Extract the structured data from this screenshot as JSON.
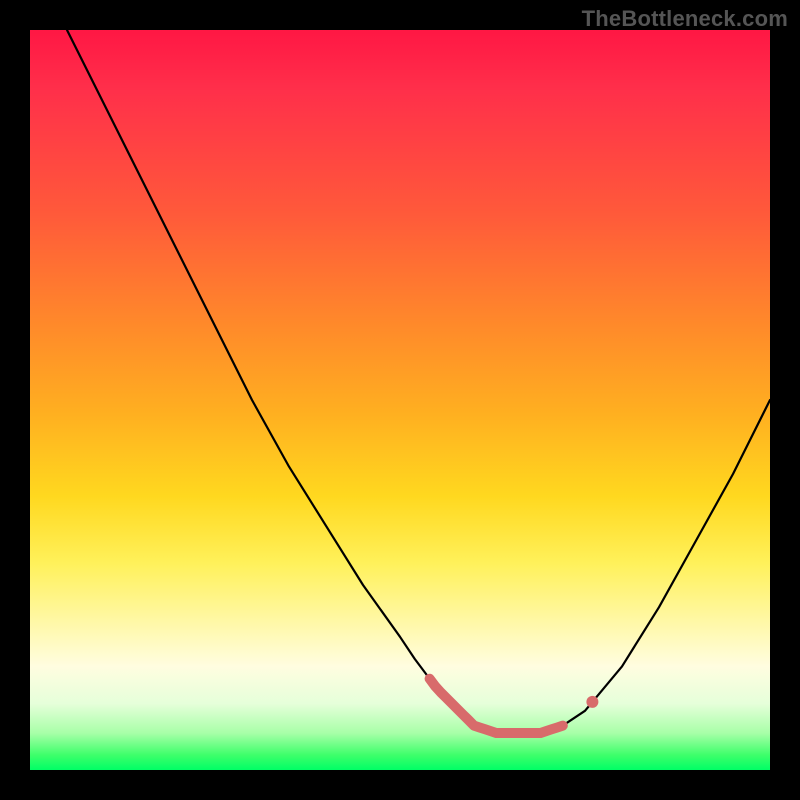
{
  "watermark": "TheBottleneck.com",
  "chart_data": {
    "type": "line",
    "title": "",
    "xlabel": "",
    "ylabel": "",
    "xlim": [
      0,
      100
    ],
    "ylim": [
      0,
      100
    ],
    "grid": false,
    "legend": false,
    "series": [
      {
        "name": "curve",
        "x": [
          5,
          10,
          15,
          20,
          25,
          30,
          35,
          40,
          45,
          50,
          52,
          55,
          58,
          60,
          63,
          66,
          69,
          72,
          75,
          80,
          85,
          90,
          95,
          100
        ],
        "y": [
          100,
          90,
          80,
          70,
          60,
          50,
          41,
          33,
          25,
          18,
          15,
          11,
          8,
          6,
          5,
          5,
          5,
          6,
          8,
          14,
          22,
          31,
          40,
          50
        ]
      }
    ],
    "highlight_range_x": [
      54,
      72
    ],
    "highlight_dot_x": 76,
    "colors": {
      "curve": "#000000",
      "highlight": "#d86b6b",
      "background_gradient_top": "#ff1744",
      "background_gradient_bottom": "#00ff66",
      "frame": "#000000"
    }
  }
}
